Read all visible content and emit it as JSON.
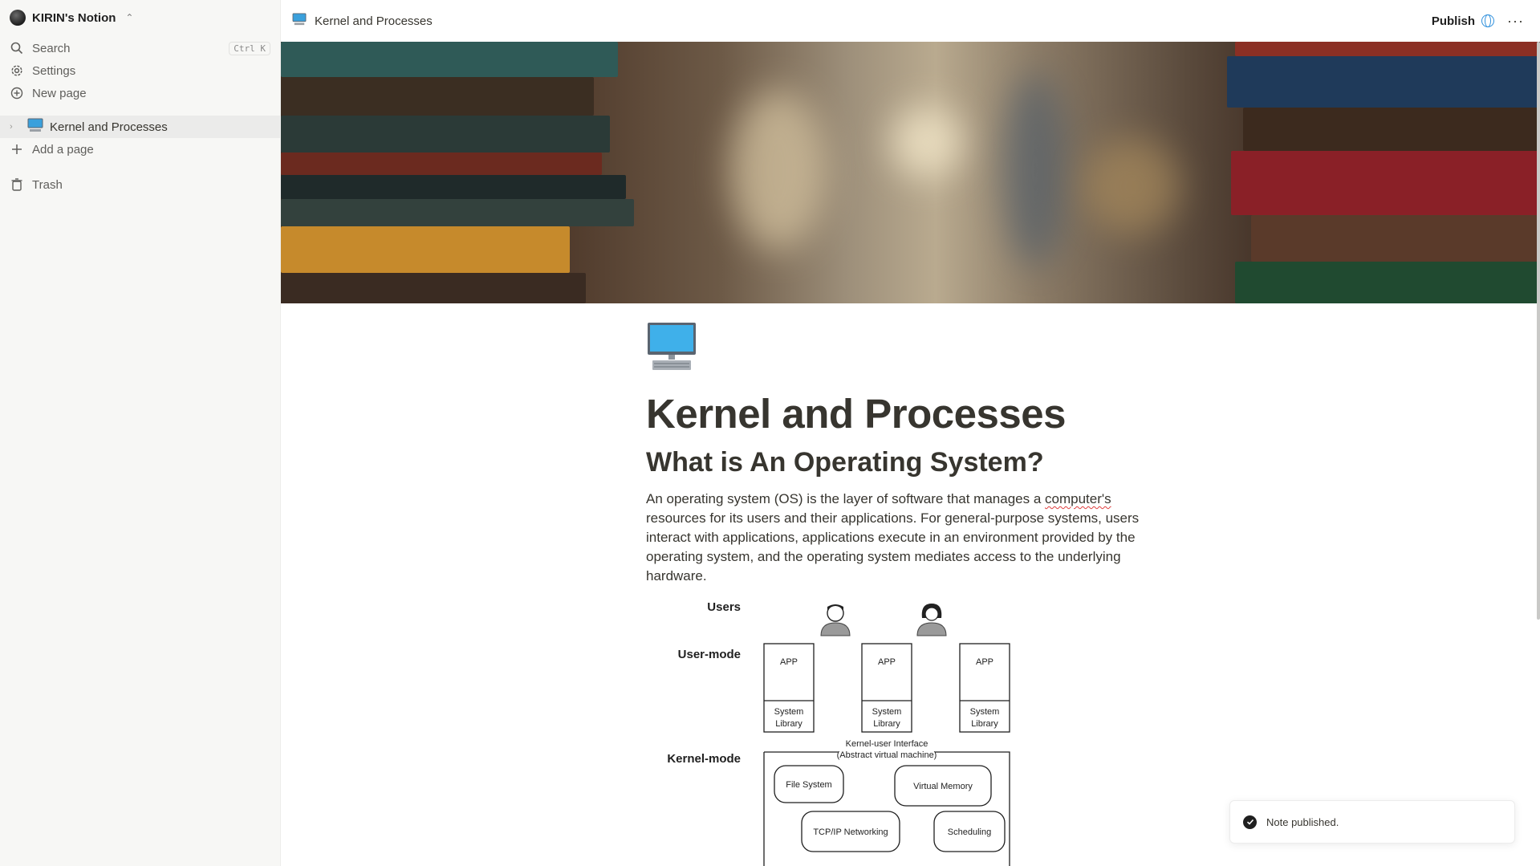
{
  "workspace": {
    "name": "KIRIN's Notion"
  },
  "sidebar": {
    "nav": [
      {
        "label": "Search",
        "icon": "search-icon",
        "shortcut": "Ctrl K"
      },
      {
        "label": "Settings",
        "icon": "gear-icon"
      },
      {
        "label": "New page",
        "icon": "plus-circle-icon"
      }
    ],
    "pages": [
      {
        "label": "Kernel and Processes",
        "icon": "desktop-computer-icon"
      }
    ],
    "add_page": "Add a page",
    "trash": "Trash"
  },
  "topbar": {
    "breadcrumb": "Kernel and Processes",
    "publish": "Publish",
    "more": "···"
  },
  "page": {
    "title": "Kernel and Processes",
    "heading": "What is An Operating System?",
    "paragraph_before": "An operating system (OS) is the layer of software that manages a ",
    "paragraph_misspelled": "computer's",
    "paragraph_after": " resources for its users and their applications. For general-purpose systems, users interact with applications, applications execute in an environment provided by the operating system, and the operating system mediates access to the underlying hardware."
  },
  "diagram": {
    "row_users": "Users",
    "row_user_mode": "User-mode",
    "row_kernel_mode": "Kernel-mode",
    "app_label": "APP",
    "lib_line1": "System",
    "lib_line2": "Library",
    "interface_line1": "Kernel-user Interface",
    "interface_line2": "(Abstract virtual machine)",
    "kernel_boxes": [
      "File System",
      "Virtual Memory",
      "TCP/IP Networking",
      "Scheduling"
    ]
  },
  "toast": {
    "message": "Note published."
  },
  "colors": {
    "sidebar_bg": "#f7f7f5",
    "accent_blue": "#2e8fdc",
    "text": "#37352f"
  }
}
